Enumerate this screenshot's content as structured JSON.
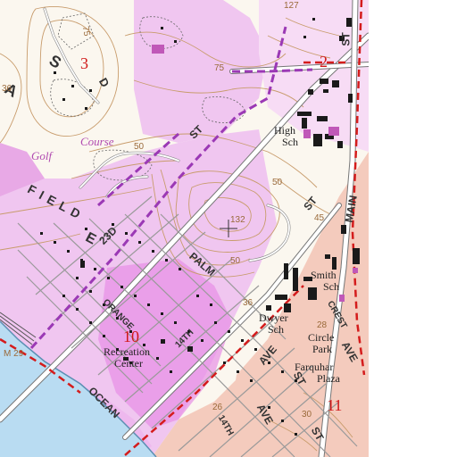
{
  "map": {
    "colors": {
      "paper": "#fbf7ef",
      "urban_tint": "#f0c6f0",
      "magenta_dense": "#e78fe6",
      "red_urban": "#f4cbbd",
      "water": "#b9dcf2",
      "contour": "#c89c6c",
      "road": "#ffffff",
      "red_boundary": "#d41c1c",
      "purple_dash": "#9b39b5",
      "building": "#1a1a1a"
    },
    "section_numbers": [
      "3",
      "2",
      "10",
      "11"
    ],
    "streets": {
      "st_top_right": "ST",
      "st_diagonal": "ST",
      "st_mid_right": "ST",
      "field": "FIELD",
      "d23": "23D",
      "palm": "PALM",
      "orange": "ORANGE",
      "ocean": "OCEAN",
      "main": "MAIN",
      "crest": "CREST",
      "ave1": "AVE",
      "ave2": "AVE",
      "ave3": "AVE",
      "st_bottom1": "ST",
      "st_bottom2": "ST",
      "th14": "14TH",
      "th_bot": "14TH",
      "s_letter": "S",
      "a_letter": "A",
      "d_letter": "D",
      "e_letter": "E"
    },
    "places": {
      "high": "High",
      "sch1": "Sch",
      "smith": "Smith",
      "sch2": "Sch",
      "dwyer": "Dwyer",
      "sch3": "Sch",
      "circle_park": "Circle",
      "park": "Park",
      "farquhar": "Farquhar",
      "plaza": "Plaza",
      "recreation": "Recreation",
      "center": "Center"
    },
    "golf": {
      "golf": "Golf",
      "course": "Course"
    },
    "contours": {
      "c127": "127",
      "c75a": "75",
      "c75b": "75",
      "c36a": "36",
      "c50a": "50",
      "c50b": "50",
      "c50c": "50",
      "c45": "45",
      "c36b": "36",
      "c28": "28",
      "c26": "26",
      "c29": "M 29",
      "c30": "30",
      "c132": "132"
    }
  }
}
